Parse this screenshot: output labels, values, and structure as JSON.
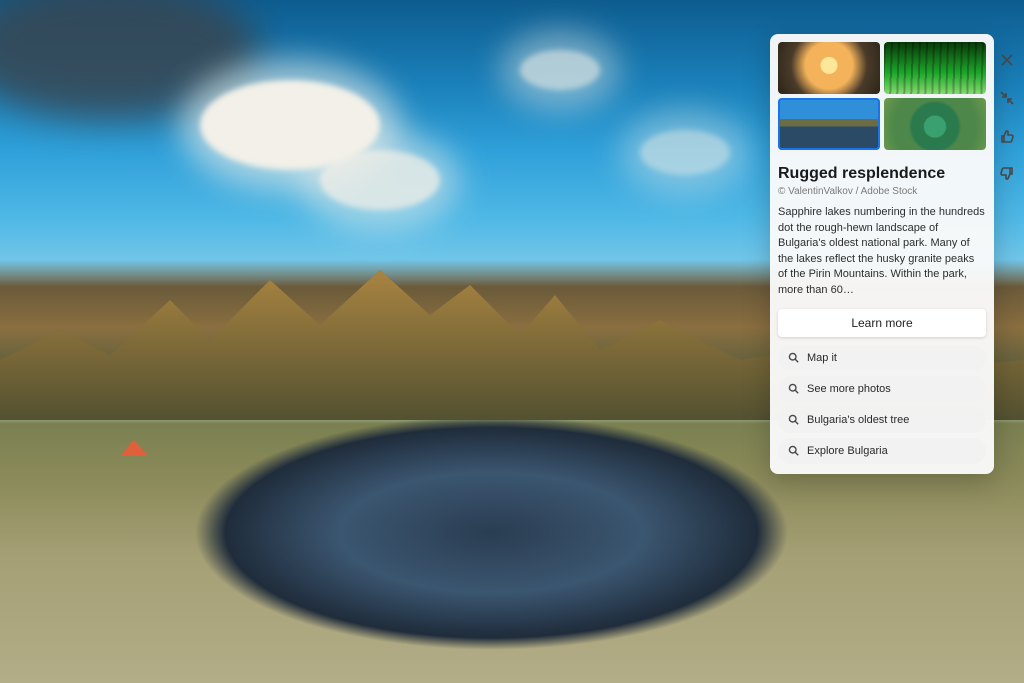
{
  "wallpaper": {
    "location_hint": "Pirin Mountains, Bulgaria"
  },
  "card": {
    "title": "Rugged resplendence",
    "credit": "© ValentinValkov / Adobe Stock",
    "description": "Sapphire lakes numbering in the hundreds dot the rough-hewn landscape of Bulgaria's oldest national park. Many of the lakes reflect the husky granite peaks of the Pirin Mountains. Within the park, more than 60…",
    "learn_more": "Learn more",
    "thumbnails": [
      {
        "name": "sunset-reflection",
        "selected": false
      },
      {
        "name": "bamboo-forest",
        "selected": false
      },
      {
        "name": "alpine-lake",
        "selected": true
      },
      {
        "name": "aerial-green",
        "selected": false
      }
    ],
    "actions": {
      "close": "Close",
      "minimize": "Minimize",
      "like": "Like this image",
      "dislike": "Not a fan"
    },
    "searches": [
      "Map it",
      "See more photos",
      "Bulgaria's oldest tree",
      "Explore Bulgaria"
    ]
  }
}
